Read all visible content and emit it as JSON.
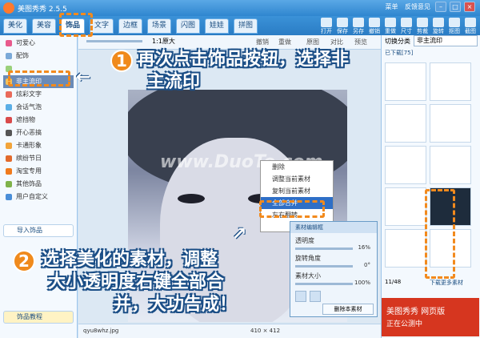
{
  "window": {
    "title": "美图秀秀 2.5.5",
    "menu": [
      "菜单",
      "反馈意见"
    ]
  },
  "tabs": [
    "美化",
    "美容",
    "饰品",
    "文字",
    "边框",
    "场景",
    "闪图",
    "娃娃",
    "拼图"
  ],
  "tab_active": "饰品",
  "toolbar": [
    "打开",
    "保存",
    "另存",
    "撤销",
    "重做",
    "尺寸",
    "剪裁",
    "旋转",
    "抠图",
    "截图"
  ],
  "sidebar": {
    "items": [
      "可爱心",
      "配饰",
      "",
      "非主流印",
      "炫彩文字",
      "会话气泡",
      "遮挡物",
      "开心恶搞",
      "卡通形象",
      "缤纷节日",
      "淘宝专用",
      "其他饰品",
      "用户自定义"
    ],
    "selected": "非主流印",
    "import_button": "导入饰品",
    "tutorial_button": "饰品教程"
  },
  "work_toolbar": {
    "zoom_label": "1:1原大",
    "actions": [
      "撤销",
      "重做",
      "原图",
      "对比",
      "预览"
    ]
  },
  "context_menu": [
    "删除",
    "调整当前素材",
    "复制当前素材",
    "全部合并",
    "左右翻转"
  ],
  "context_menu_highlight": "全部合并",
  "material_panel": {
    "title": "素材编辑框",
    "transparency_label": "透明度",
    "transparency_value": "16%",
    "rotate_label": "旋转角度",
    "rotate_value": "0°",
    "size_label": "素材大小",
    "size_value": "100%",
    "delete_button": "删除本素材"
  },
  "status": {
    "filename": "qyu8whz.jpg",
    "dimensions": "410 × 412"
  },
  "right_panel": {
    "category_label": "切换分类",
    "category_value": "非主流印",
    "tab_label": "已下载[75]",
    "pager": "11/48",
    "download_label": "下载更多素材"
  },
  "callouts": {
    "step1_num": "1",
    "step1_line1": "再次点击饰品按钮，选择非",
    "step1_line2": "主流印",
    "step2_num": "2",
    "step2_line1": "选择美化的素材，调整",
    "step2_line2": "大小透明度右键全部合",
    "step2_line3": "并，大功告成！"
  },
  "watermark": "www.DuoTe.com",
  "ad": {
    "line1": "美图秀秀 网页版",
    "line2": "正在公测中"
  },
  "colors": {
    "accent": "#f28a1d",
    "titlebar": "#2f86cf",
    "callout_outline": "#1b4e86"
  }
}
